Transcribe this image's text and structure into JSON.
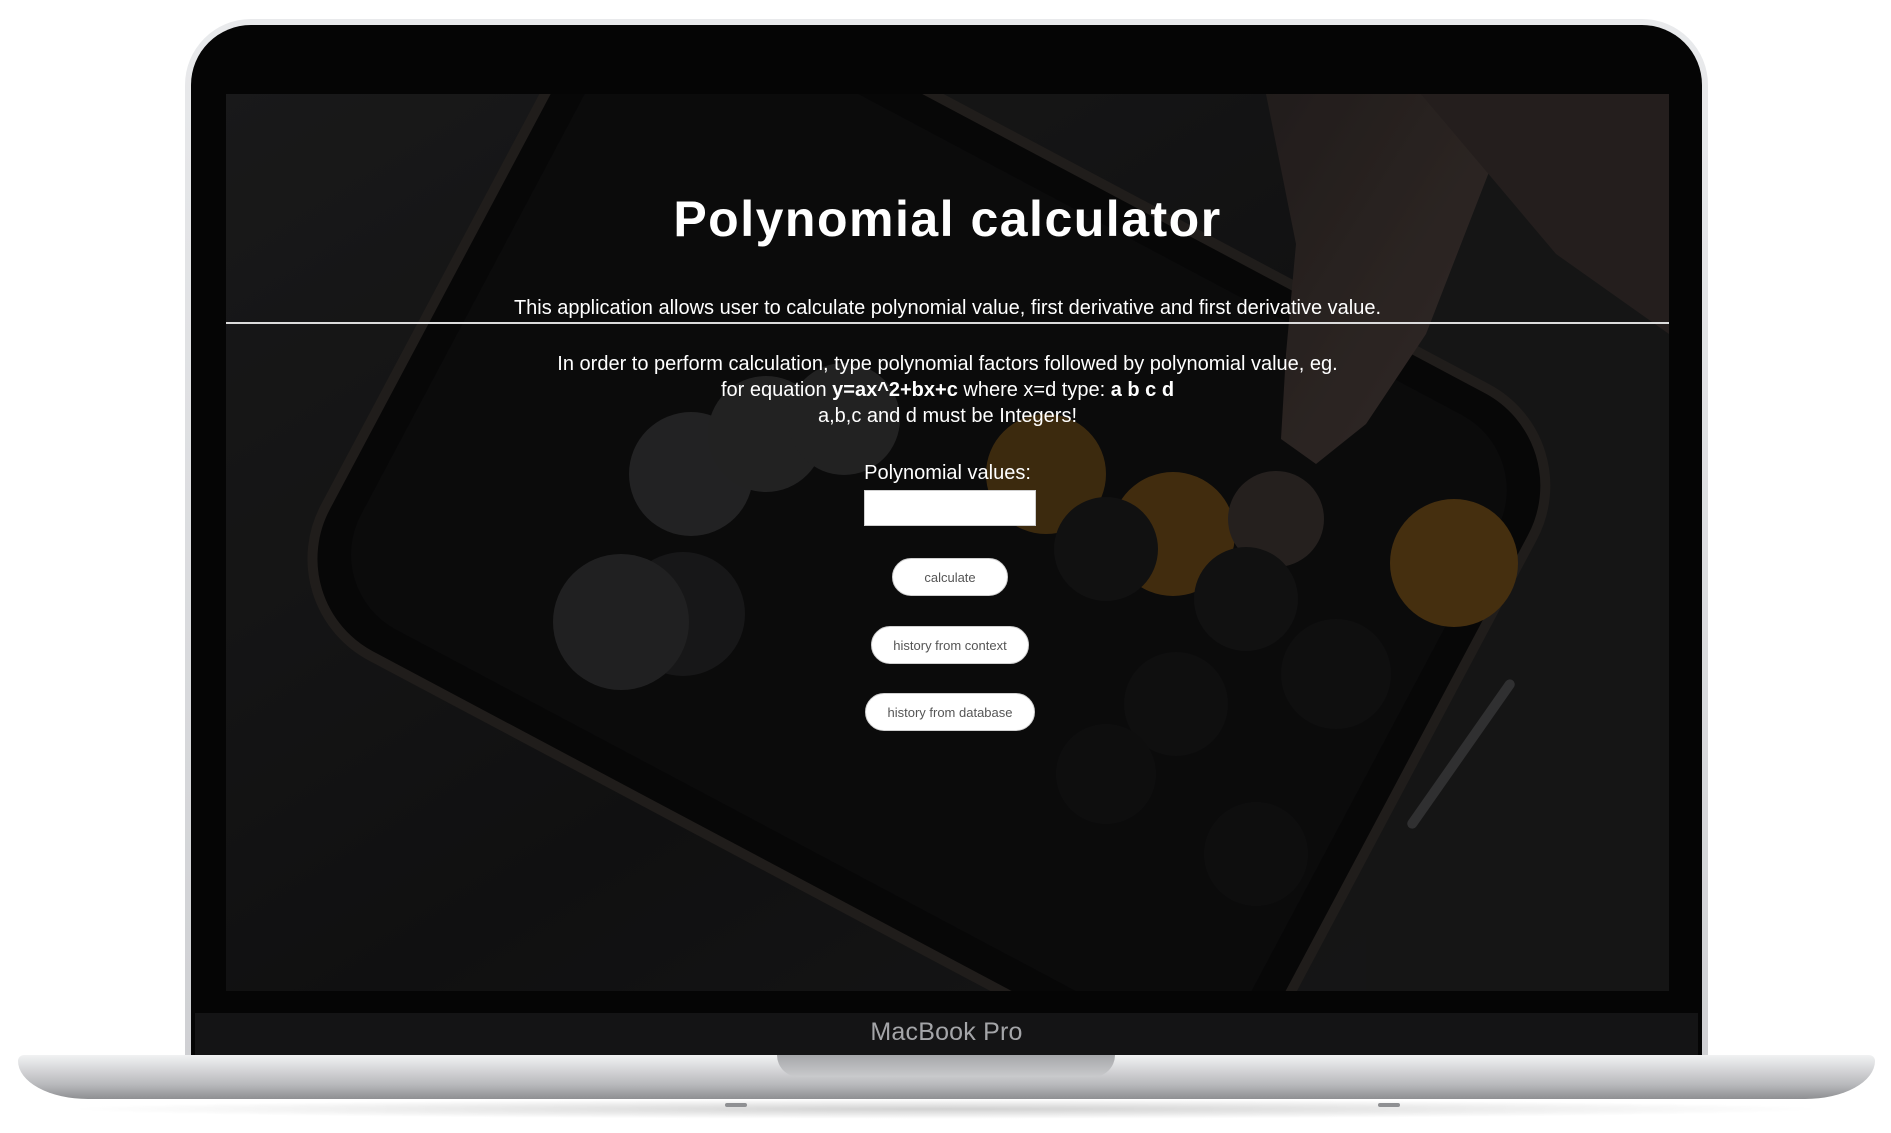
{
  "device": {
    "model_label": "MacBook Pro"
  },
  "page": {
    "title": "Polynomial calculator",
    "intro": "This application allows user to calculate polynomial value, first derivative and first derivative value.",
    "instructions": {
      "line1": "In order to perform calculation, type polynomial factors followed by polynomial value, eg.",
      "line2_prefix": "for equation ",
      "line2_equation": "y=ax^2+bx+c",
      "line2_middle": " where x=d type: ",
      "line2_format": "a b c d",
      "line3": "a,b,c and d must be Integers!"
    },
    "form": {
      "label": "Polynomial values:",
      "input_value": "",
      "input_placeholder": ""
    },
    "buttons": {
      "calculate": "calculate",
      "history_context": "history from context",
      "history_database": "history from database"
    }
  },
  "colors": {
    "text": "#ffffff",
    "button_bg": "#ffffff",
    "button_text": "#555555",
    "accent_orange": "#b87a1c"
  }
}
